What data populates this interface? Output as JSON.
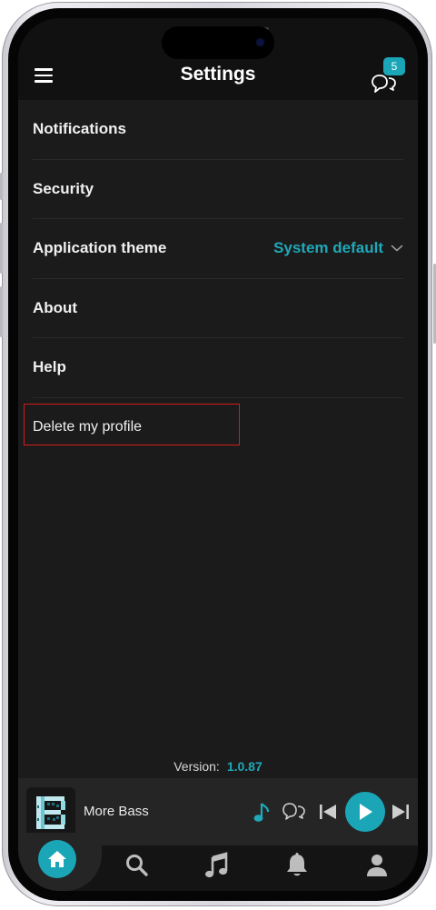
{
  "header": {
    "title": "Settings",
    "menu_icon": "hamburger-menu-icon",
    "chat_icon": "chat-bubbles-icon",
    "chat_badge_count": "5"
  },
  "settings": {
    "items": [
      {
        "label": "Notifications"
      },
      {
        "label": "Security"
      },
      {
        "label": "Application theme",
        "value": "System default",
        "value_icon": "chevron-down-icon"
      },
      {
        "label": "About"
      },
      {
        "label": "Help"
      },
      {
        "label": "Delete my profile",
        "highlighted": true
      }
    ]
  },
  "footer": {
    "version_label": "Version:",
    "version_number": "1.0.87"
  },
  "player": {
    "track_title": "More Bass",
    "controls": [
      "music-note-icon",
      "chat-bubbles-icon",
      "previous-icon",
      "play-icon",
      "next-icon"
    ]
  },
  "tabs": [
    {
      "name": "home",
      "icon": "home-icon",
      "active": true
    },
    {
      "name": "search",
      "icon": "search-icon"
    },
    {
      "name": "music",
      "icon": "music-note-icon"
    },
    {
      "name": "notifications",
      "icon": "bell-icon"
    },
    {
      "name": "profile",
      "icon": "user-icon"
    }
  ],
  "colors": {
    "accent": "#1aa6b7",
    "background": "#1b1b1b",
    "header": "#111111",
    "highlight": "#d11b1b"
  }
}
